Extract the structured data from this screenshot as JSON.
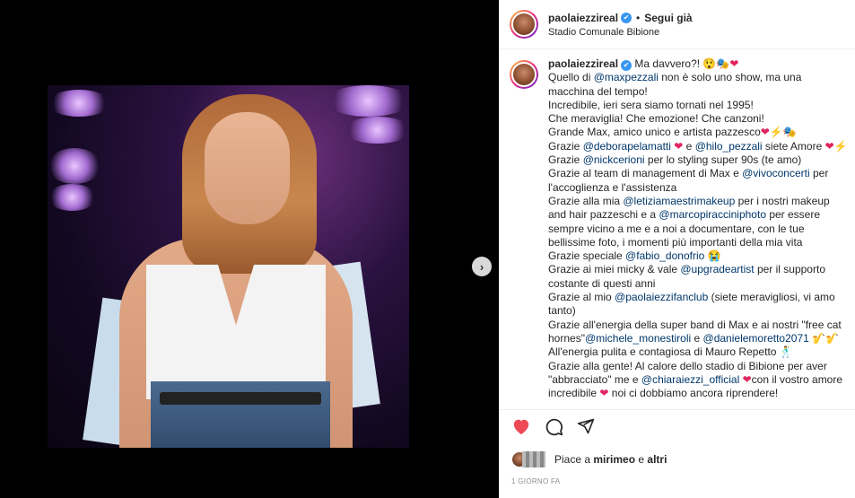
{
  "post": {
    "username": "paolaiezzireal",
    "verified_icon": "✔",
    "separator": "•",
    "follow_label": "Segui già",
    "location": "Stadio Comunale Bibione"
  },
  "media": {
    "carousel_dots": 5,
    "active_dot": 3,
    "next_icon": "›"
  },
  "caption": {
    "username": "paolaiezzireal",
    "lines": [
      [
        {
          "t": "Ma davvero?! 😲🎭"
        },
        {
          "t": "❤",
          "heart": true
        }
      ],
      [
        {
          "t": "Quello di "
        },
        {
          "t": "@maxpezzali",
          "m": true
        },
        {
          "t": " non è solo uno show, ma una macchina del tempo!"
        }
      ],
      [
        {
          "t": "Incredibile, ieri sera siamo tornati nel 1995!"
        }
      ],
      [
        {
          "t": "Che meraviglia! Che emozione! Che canzoni!"
        }
      ],
      [
        {
          "t": "Grande Max, amico unico e artista pazzesco"
        },
        {
          "t": "❤",
          "heart": true
        },
        {
          "t": "⚡🎭"
        }
      ],
      [
        {
          "t": "Grazie "
        },
        {
          "t": "@deborapelamatti",
          "m": true
        },
        {
          "t": " "
        },
        {
          "t": "❤",
          "heart": true
        },
        {
          "t": " e "
        },
        {
          "t": "@hilo_pezzali",
          "m": true
        },
        {
          "t": " siete Amore "
        },
        {
          "t": "❤",
          "heart": true
        },
        {
          "t": "⚡"
        }
      ],
      [
        {
          "t": "Grazie "
        },
        {
          "t": "@nickcerioni",
          "m": true
        },
        {
          "t": " per lo styling super 90s (te amo)"
        }
      ],
      [
        {
          "t": "Grazie al team di management di Max e "
        },
        {
          "t": "@vivoconcerti",
          "m": true
        },
        {
          "t": " per l'accoglienza e l'assistenza"
        }
      ],
      [
        {
          "t": "Grazie alla mia "
        },
        {
          "t": "@letiziamaestrimakeup",
          "m": true
        },
        {
          "t": " per i nostri makeup and hair pazzeschi e a "
        },
        {
          "t": "@marcopiraccinіphoto",
          "m": true
        },
        {
          "t": " per essere sempre vicino a me e a noi a documentare, con le tue bellissime foto, i momenti più importanti della mia vita"
        }
      ],
      [
        {
          "t": "Grazie speciale "
        },
        {
          "t": "@fabio_donofrio",
          "m": true
        },
        {
          "t": " 😭"
        }
      ],
      [
        {
          "t": "Grazie ai miei micky & vale "
        },
        {
          "t": "@upgradeartist",
          "m": true
        },
        {
          "t": " per il supporto costante di questi anni"
        }
      ],
      [
        {
          "t": "Grazie al mio "
        },
        {
          "t": "@paolaiezzifanclub",
          "m": true
        },
        {
          "t": " (siete meravigliosi, vi amo tanto)"
        }
      ],
      [
        {
          "t": "Grazie all'energia della super band di Max e ai nostri \"free cat hornes\""
        },
        {
          "t": "@michele_monestiroli",
          "m": true
        },
        {
          "t": " e "
        },
        {
          "t": "@danielemoretto2071",
          "m": true
        },
        {
          "t": " 🎷🎷"
        }
      ],
      [
        {
          "t": "All'energia pulita e contagiosa di Mauro Repetto 🕺"
        }
      ],
      [
        {
          "t": "Grazie alla gente! Al calore dello stadio di Bibione per aver \"abbracciato\" me e "
        },
        {
          "t": "@chiaraiezzi_official",
          "m": true
        },
        {
          "t": " "
        },
        {
          "t": "❤",
          "heart": true
        },
        {
          "t": "con il vostro amore incredibile "
        },
        {
          "t": "❤",
          "heart": true
        },
        {
          "t": " noi ci dobbiamo ancora riprendere!"
        }
      ]
    ]
  },
  "actions": {
    "like_icon": "heart-filled-icon",
    "comment_icon": "comment-icon",
    "share_icon": "share-icon",
    "like_color": "#ed4956"
  },
  "likes": {
    "prefix": "Piace a ",
    "user": "mirimeo",
    "conj": " e ",
    "others": "altri"
  },
  "timestamp": "1 GIORNO FA"
}
